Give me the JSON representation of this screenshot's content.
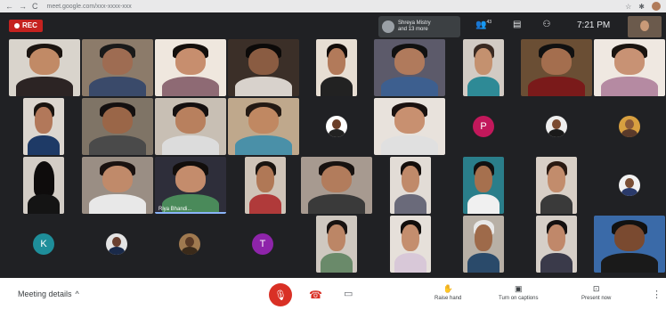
{
  "browser": {
    "url": "meet.google.com/xxx-xxxx-xxx",
    "nav_back": "←",
    "nav_forward": "→",
    "nav_reload": "C",
    "icons": [
      "star-icon",
      "puzzle-icon",
      "profile-icon"
    ]
  },
  "topbar": {
    "rec_label": "REC",
    "presenter_line1": "Shreya Mistry",
    "presenter_line2": "and 13 more",
    "people_count": "43",
    "time": "7:21 PM"
  },
  "tiles": {
    "active_speaker_name": "Riya Bhandi..."
  },
  "avatars": {
    "k": "K",
    "p": "P",
    "t": "T",
    "k_color": "#1e8e9a",
    "p_color": "#c2185b",
    "t_color": "#8e24aa"
  },
  "bottombar": {
    "meeting_details": "Meeting details",
    "chevron": "^",
    "raise_hand": "Raise hand",
    "captions": "Turn on captions",
    "present": "Present now",
    "more": "⋮"
  }
}
